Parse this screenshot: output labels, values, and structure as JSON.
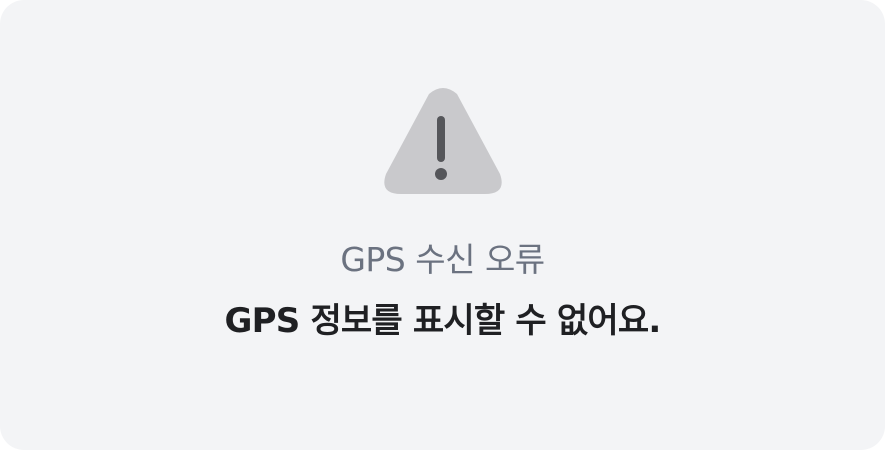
{
  "error_card": {
    "icon": "warning-triangle-icon",
    "title": "GPS 수신 오류",
    "message": "GPS 정보를 표시할 수 없어요."
  },
  "colors": {
    "card_background": "#f3f4f6",
    "icon_fill": "#c9c9cc",
    "icon_mark": "#55565a",
    "title_text": "#6b7280",
    "message_text": "#1f2023"
  }
}
